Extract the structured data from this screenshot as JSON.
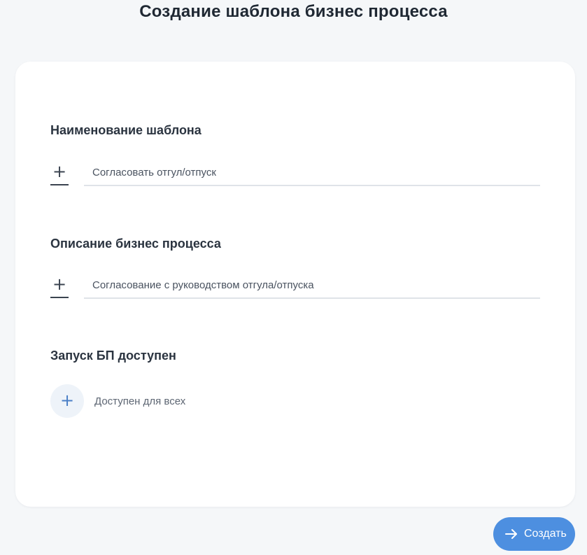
{
  "page": {
    "title": "Создание шаблона бизнес процесса"
  },
  "form": {
    "template_name": {
      "label": "Наименование шаблона",
      "value": "Согласовать отгул/отпуск"
    },
    "description": {
      "label": "Описание бизнес процесса",
      "value": "Согласование с руководством отгула/отпуска"
    },
    "launch_access": {
      "label": "Запуск БП доступен",
      "value": "Доступен для всех"
    }
  },
  "actions": {
    "create_label": "Создать"
  },
  "icons": {
    "add_name": "plus-icon",
    "add_description": "plus-icon",
    "add_access": "plus-icon",
    "create": "arrow-right-icon"
  },
  "colors": {
    "background": "#f5f7f9",
    "card": "#ffffff",
    "accent": "#4d8fe0",
    "text_primary": "#2b3440"
  }
}
